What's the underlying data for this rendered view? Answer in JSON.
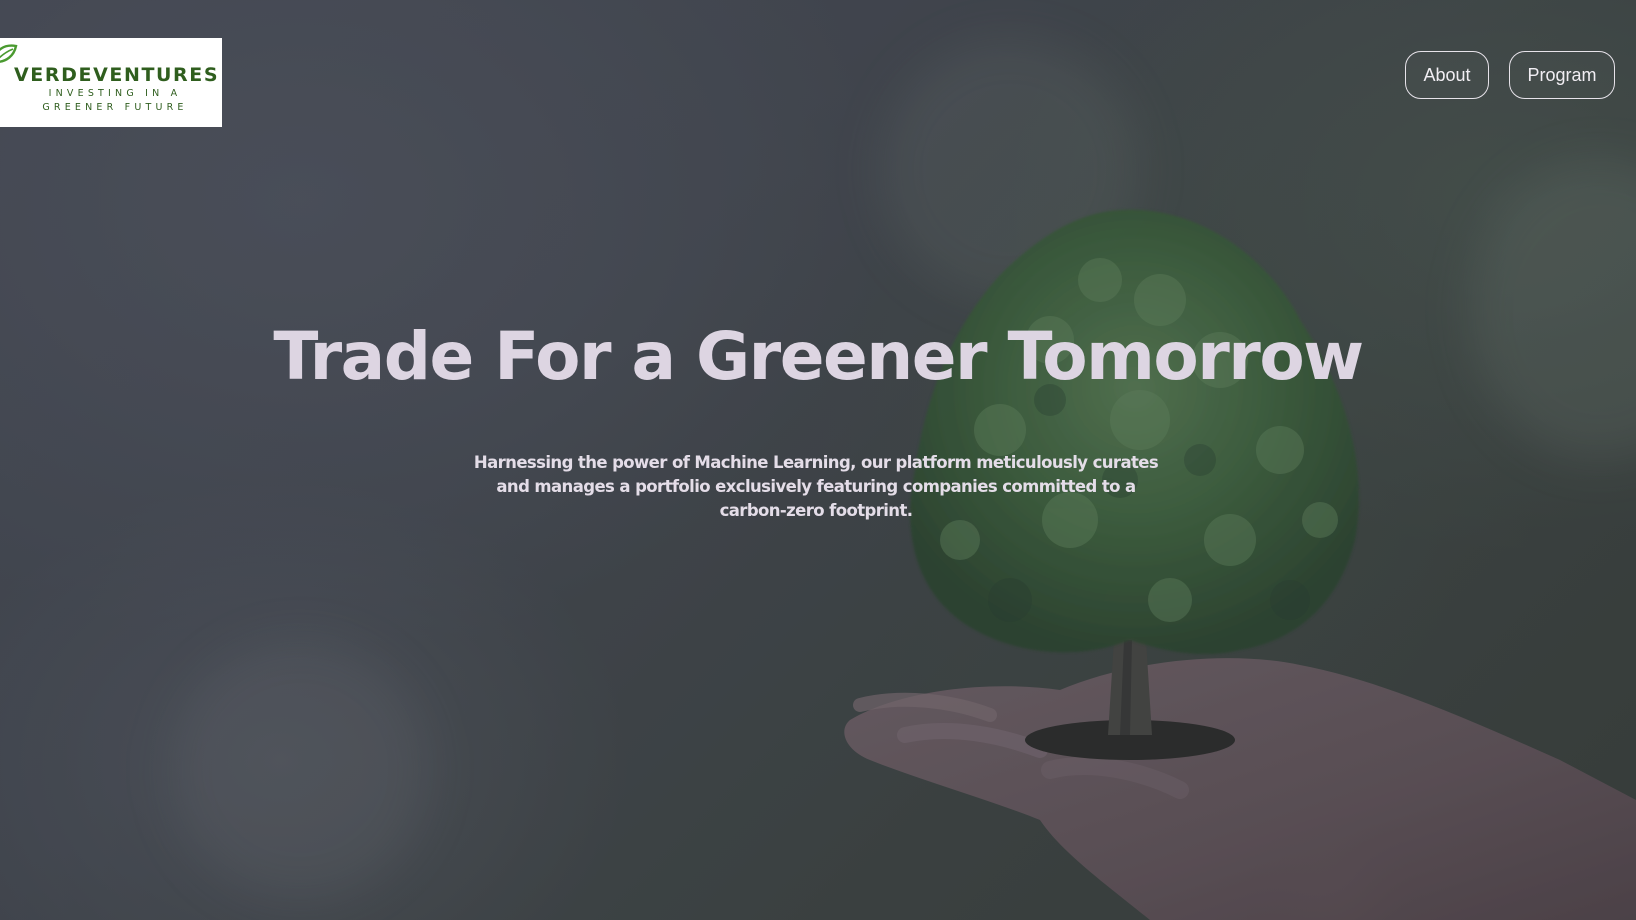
{
  "brand": {
    "name": "VERDEVENTURES",
    "tagline_line1": "INVESTING IN A",
    "tagline_line2": "GREENER FUTURE",
    "color": "#2f5e1e"
  },
  "nav": {
    "items": [
      {
        "label": "About"
      },
      {
        "label": "Program"
      }
    ]
  },
  "hero": {
    "headline": "Trade For a Greener Tomorrow",
    "subtext": "Harnessing the power of Machine Learning, our platform meticulously curates and manages a portfolio exclusively featuring companies committed to a carbon-zero footprint.",
    "background_image": "tree-in-hands-photo",
    "text_color": "#ddd5e2"
  }
}
